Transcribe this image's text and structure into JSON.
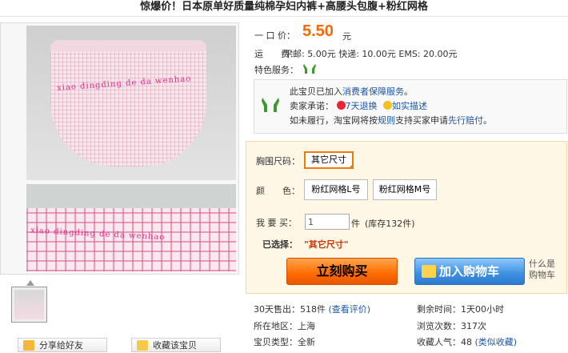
{
  "title": "惊爆价！日本原单好质量纯棉孕妇内裤+高腰头包腹+粉红网格",
  "photo": {
    "watermark_top": "xiao dingding de da wenhao",
    "watermark_bottom": "xiao dingding de da wenhao"
  },
  "price": {
    "label": "一 口 价：",
    "value": "5.50",
    "unit": "元"
  },
  "shipping": {
    "label": "运　　费：",
    "value": "平邮: 5.00元 快递: 10.00元 EMS: 20.00元"
  },
  "service": {
    "label": "特色服务：",
    "icon": "guarantee-hands-icon"
  },
  "guarantee": {
    "line1_prefix": "此宝贝已加入",
    "line1_link": "消费者保障服务",
    "line1_suffix": "。",
    "line2_label": "卖家承诺：",
    "promise1": "7天退换",
    "promise2": "如实描述",
    "line3_prefix": "如未履行，淘宝网将按",
    "line3_link1": "规则",
    "line3_mid": "支持买家申请",
    "line3_link2": "先行赔付",
    "line3_suffix": "。"
  },
  "buy": {
    "size_label": "胸围尺码：",
    "size_option": "其它尺寸",
    "color_label": "颜　　色：",
    "color_options": [
      "粉红网格L号",
      "粉红网格M号"
    ],
    "qty_label": "我 要 买：",
    "qty_value": "1",
    "qty_unit": "件",
    "stock": "(库存132件)",
    "selected_label": "已选择：",
    "selected_value": "\"其它尺寸\"",
    "buy_now": "立刻购买",
    "add_cart": "加入购物车",
    "whatis_line1": "什么是",
    "whatis_line2": "购物车"
  },
  "stats": {
    "sold_label": "30天售出：",
    "sold_value": "518件",
    "review_link": "(查看评价)",
    "remaining_label": "剩余时间：",
    "remaining_value": "1天00小时",
    "location_label": "所在地区：",
    "location_value": "上海",
    "views_label": "浏览次数：",
    "views_value": "317次",
    "type_label": "宝贝类型：",
    "type_value": "全新",
    "popularity_label": "收藏人气：",
    "popularity_value": "48",
    "popularity_link": "(类似收藏)"
  },
  "actions": {
    "share": "分享给好友",
    "favorite": "收藏该宝贝"
  },
  "colors": {
    "price": "#ff6600",
    "link": "#1c56a5",
    "buy_button": "#ff6a00",
    "cart_button": "#3d8fe0",
    "selected_border": "#f07800"
  }
}
